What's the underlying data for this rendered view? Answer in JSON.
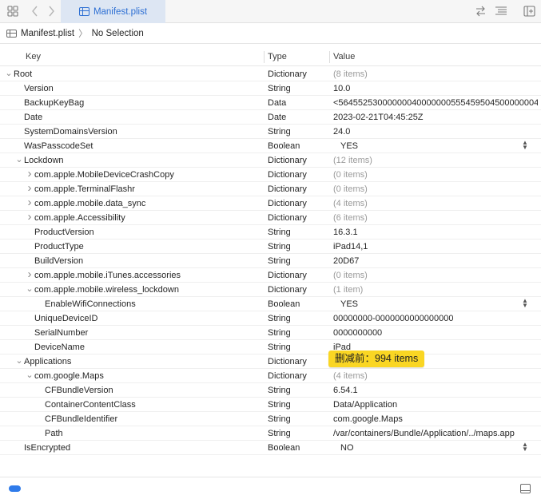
{
  "toolbar": {
    "tab_title": "Manifest.plist",
    "icons": [
      "grid-icon",
      "back-icon",
      "forward-icon",
      "swap-icon",
      "lines-icon",
      "add-panel-icon"
    ]
  },
  "pathbar": {
    "file": "Manifest.plist",
    "selection": "No Selection"
  },
  "columns": {
    "key": "Key",
    "type": "Type",
    "value": "Value"
  },
  "rows": [
    {
      "key": "Root",
      "type": "Dictionary",
      "value": "(8 items)",
      "depth": 0,
      "disclosure": "open",
      "dim": true
    },
    {
      "key": "Version",
      "type": "String",
      "value": "10.0",
      "depth": 1
    },
    {
      "key": "BackupKeyBag",
      "type": "Data",
      "value": "<56455253000000040000000555459504500000004",
      "depth": 1
    },
    {
      "key": "Date",
      "type": "Date",
      "value": "2023-02-21T04:45:25Z",
      "depth": 1
    },
    {
      "key": "SystemDomainsVersion",
      "type": "String",
      "value": "24.0",
      "depth": 1
    },
    {
      "key": "WasPasscodeSet",
      "type": "Boolean",
      "value": "YES",
      "depth": 1,
      "bool": true
    },
    {
      "key": "Lockdown",
      "type": "Dictionary",
      "value": "(12 items)",
      "depth": 1,
      "disclosure": "open",
      "dim": true
    },
    {
      "key": "com.apple.MobileDeviceCrashCopy",
      "type": "Dictionary",
      "value": "(0 items)",
      "depth": 2,
      "disclosure": "closed",
      "dim": true
    },
    {
      "key": "com.apple.TerminalFlashr",
      "type": "Dictionary",
      "value": "(0 items)",
      "depth": 2,
      "disclosure": "closed",
      "dim": true
    },
    {
      "key": "com.apple.mobile.data_sync",
      "type": "Dictionary",
      "value": "(4 items)",
      "depth": 2,
      "disclosure": "closed",
      "dim": true
    },
    {
      "key": "com.apple.Accessibility",
      "type": "Dictionary",
      "value": "(6 items)",
      "depth": 2,
      "disclosure": "closed",
      "dim": true
    },
    {
      "key": "ProductVersion",
      "type": "String",
      "value": "16.3.1",
      "depth": 2
    },
    {
      "key": "ProductType",
      "type": "String",
      "value": "iPad14,1",
      "depth": 2
    },
    {
      "key": "BuildVersion",
      "type": "String",
      "value": "20D67",
      "depth": 2
    },
    {
      "key": "com.apple.mobile.iTunes.accessories",
      "type": "Dictionary",
      "value": "(0 items)",
      "depth": 2,
      "disclosure": "closed",
      "dim": true
    },
    {
      "key": "com.apple.mobile.wireless_lockdown",
      "type": "Dictionary",
      "value": "(1 item)",
      "depth": 2,
      "disclosure": "open",
      "dim": true
    },
    {
      "key": "EnableWifiConnections",
      "type": "Boolean",
      "value": "YES",
      "depth": 3,
      "bool": true
    },
    {
      "key": "UniqueDeviceID",
      "type": "String",
      "value": "00000000-0000000000000000",
      "depth": 2
    },
    {
      "key": "SerialNumber",
      "type": "String",
      "value": "0000000000",
      "depth": 2
    },
    {
      "key": "DeviceName",
      "type": "String",
      "value": "iPad",
      "depth": 2
    },
    {
      "key": "Applications",
      "type": "Dictionary",
      "value": "",
      "depth": 1,
      "disclosure": "open",
      "badge": "删减前：994 items"
    },
    {
      "key": "com.google.Maps",
      "type": "Dictionary",
      "value": "(4 items)",
      "depth": 2,
      "disclosure": "open",
      "dim": true
    },
    {
      "key": "CFBundleVersion",
      "type": "String",
      "value": "6.54.1",
      "depth": 3
    },
    {
      "key": "ContainerContentClass",
      "type": "String",
      "value": "Data/Application",
      "depth": 3
    },
    {
      "key": "CFBundleIdentifier",
      "type": "String",
      "value": "com.google.Maps",
      "depth": 3
    },
    {
      "key": "Path",
      "type": "String",
      "value": "/var/containers/Bundle/Application/../maps.app",
      "depth": 3
    },
    {
      "key": "IsEncrypted",
      "type": "Boolean",
      "value": "NO",
      "depth": 1,
      "bool": true
    }
  ],
  "colors": {
    "accent": "#2d6fd3",
    "badge": "#fad623",
    "status_pill": "#2f7bea"
  }
}
